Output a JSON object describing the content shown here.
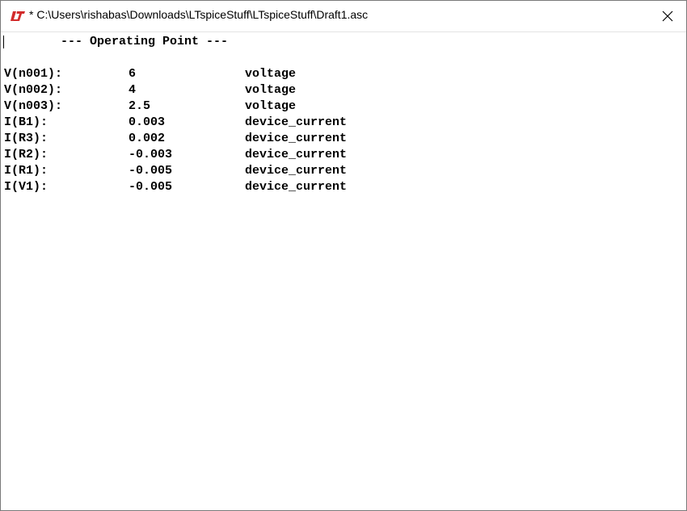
{
  "window": {
    "title": "* C:\\Users\\rishabas\\Downloads\\LTspiceStuff\\LTspiceStuff\\Draft1.asc",
    "app_icon": "ltspice-logo-icon",
    "close_icon": "close-icon"
  },
  "output": {
    "heading": "--- Operating Point ---",
    "rows": [
      {
        "name": "V(n001):",
        "value": "6",
        "type": "voltage"
      },
      {
        "name": "V(n002):",
        "value": "4",
        "type": "voltage"
      },
      {
        "name": "V(n003):",
        "value": "2.5",
        "type": "voltage"
      },
      {
        "name": "I(B1):",
        "value": "0.003",
        "type": "device_current"
      },
      {
        "name": "I(R3):",
        "value": "0.002",
        "type": "device_current"
      },
      {
        "name": "I(R2):",
        "value": "-0.003",
        "type": "device_current"
      },
      {
        "name": "I(R1):",
        "value": "-0.005",
        "type": "device_current"
      },
      {
        "name": "I(V1):",
        "value": "-0.005",
        "type": "device_current"
      }
    ]
  },
  "colors": {
    "logo_red": "#d22b2b",
    "text": "#000000",
    "background": "#ffffff"
  }
}
